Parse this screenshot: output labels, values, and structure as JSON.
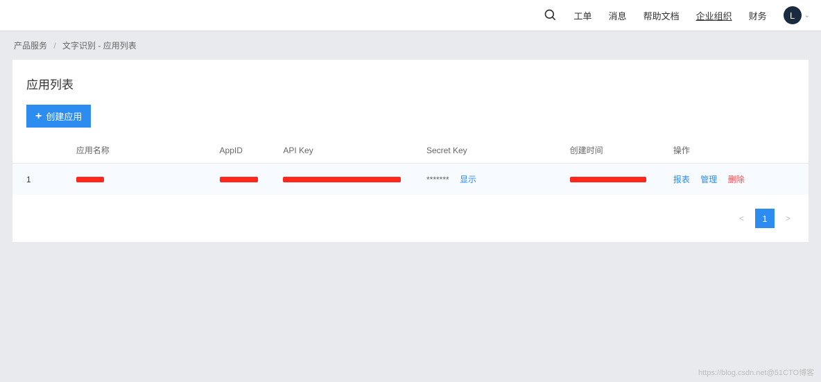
{
  "topbar": {
    "links": {
      "ticket": "工单",
      "message": "消息",
      "help_doc": "帮助文档",
      "org": "企业组织",
      "finance": "财务"
    },
    "avatar_letter": "L"
  },
  "breadcrumb": {
    "root": "产品服务",
    "sep": "/",
    "current": "文字识别 - 应用列表"
  },
  "card": {
    "title": "应用列表",
    "create_button": "创建应用"
  },
  "table": {
    "headers": {
      "index": "",
      "app_name": "应用名称",
      "app_id": "AppID",
      "api_key": "API Key",
      "secret_key": "Secret Key",
      "created": "创建时间",
      "ops": "操作"
    },
    "rows": [
      {
        "index": "1",
        "secret_mask": "*******",
        "show_label": "显示",
        "ops": {
          "report": "报表",
          "manage": "管理",
          "delete": "删除"
        }
      }
    ]
  },
  "pagination": {
    "prev": "<",
    "page": "1",
    "next": ">"
  },
  "watermark": "https://blog.csdn.net@51CTO博客"
}
